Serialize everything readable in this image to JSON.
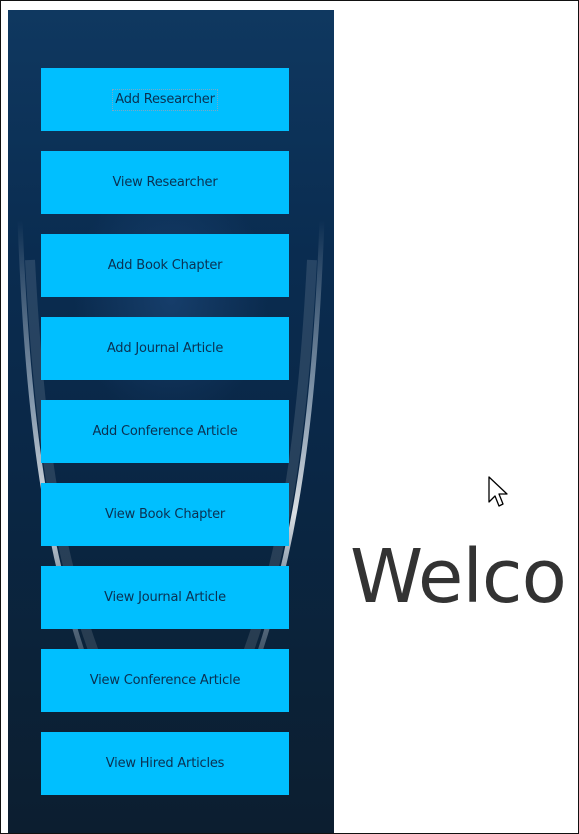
{
  "sidebar": {
    "items": [
      {
        "label": "Add Researcher"
      },
      {
        "label": "View Researcher"
      },
      {
        "label": "Add Book Chapter"
      },
      {
        "label": "Add Journal Article"
      },
      {
        "label": "Add Conference Article"
      },
      {
        "label": "View Book Chapter"
      },
      {
        "label": "View Journal Article"
      },
      {
        "label": "View Conference Article"
      },
      {
        "label": "View Hired Articles"
      }
    ],
    "focused_index": 0
  },
  "main": {
    "welcome_text": "Welco"
  },
  "colors": {
    "sidebar_background": "#0a2c50",
    "button_background": "#00bfff",
    "button_text": "#0a3152",
    "welcome_text": "#333333"
  },
  "icons": {
    "cursor": "mouse-pointer-icon"
  }
}
